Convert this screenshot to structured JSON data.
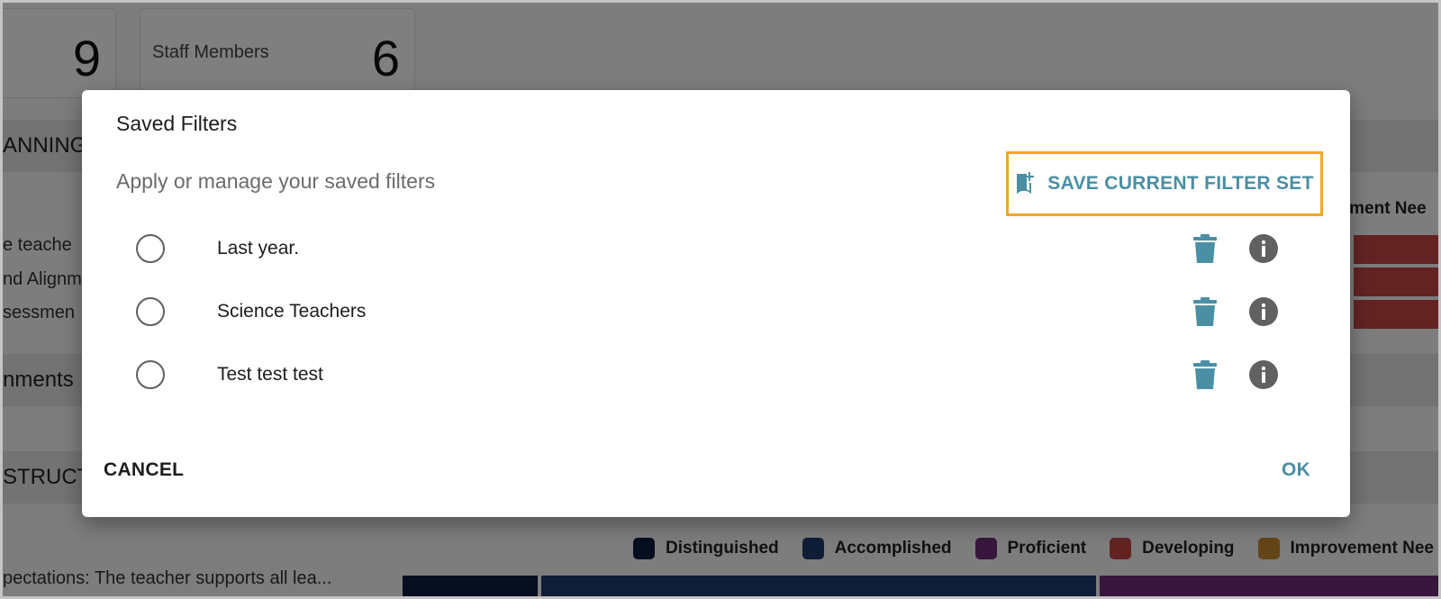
{
  "background": {
    "stat_cards": [
      {
        "label": "",
        "value": "9"
      },
      {
        "label": "Staff Members",
        "value": "6"
      }
    ],
    "sections": [
      "ANNING",
      "nments",
      "STRUCT"
    ],
    "row_labels": [
      "e teache",
      "nd Alignm",
      "sessmen"
    ],
    "column_header": "vement Nee",
    "bottom_row_label": "pectations: The teacher supports all lea...",
    "legend": [
      {
        "label": "Distinguished",
        "color": "#0d1f3f"
      },
      {
        "label": "Accomplished",
        "color": "#1f3a6e"
      },
      {
        "label": "Proficient",
        "color": "#6e2e78"
      },
      {
        "label": "Developing",
        "color": "#c74646"
      },
      {
        "label": "Improvement Nee",
        "color": "#c98b2f"
      }
    ]
  },
  "dialog": {
    "title": "Saved Filters",
    "subtitle": "Apply or manage your saved filters",
    "save_button_label": "SAVE CURRENT FILTER SET",
    "filters": [
      {
        "label": "Last year."
      },
      {
        "label": "Science Teachers"
      },
      {
        "label": "Test test test"
      }
    ],
    "cancel_label": "CANCEL",
    "ok_label": "OK"
  },
  "colors": {
    "accent": "#4a8fa3",
    "highlight": "#f5a623"
  },
  "icons": {
    "save": "bookmark-add-icon",
    "delete": "trash-icon",
    "info": "info-icon"
  }
}
